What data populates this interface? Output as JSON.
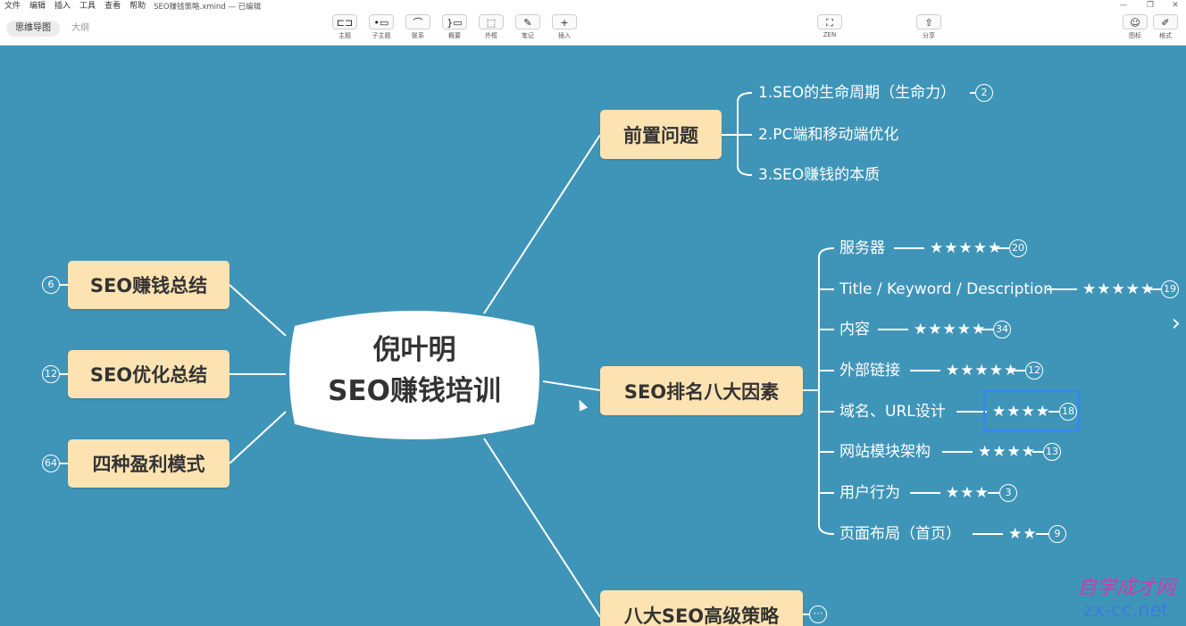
{
  "menubar": {
    "items": [
      "文件",
      "编辑",
      "插入",
      "工具",
      "查看",
      "帮助"
    ],
    "file_title": "SEO赚钱策略.xmind — 已编辑",
    "controls": [
      "—",
      "❐",
      "✕"
    ]
  },
  "toolbar": {
    "view_tabs": [
      "思维导图",
      "大纲"
    ],
    "tools": [
      {
        "icon": "⊏⊐",
        "label": "主题"
      },
      {
        "icon": "•▭",
        "label": "子主题"
      },
      {
        "icon": "⌒",
        "label": "联系"
      },
      {
        "icon": "}▭",
        "label": "概要"
      },
      {
        "icon": "⬚",
        "label": "外框"
      },
      {
        "icon": "✎",
        "label": "笔记"
      },
      {
        "icon": "+",
        "label": "插入"
      }
    ],
    "zen": {
      "icon": "⛶",
      "label": "ZEN"
    },
    "share": {
      "icon": "⇧",
      "label": "分享"
    },
    "right_tools": [
      {
        "icon": "☺",
        "label": "图标"
      },
      {
        "icon": "✐",
        "label": "格式"
      }
    ]
  },
  "mindmap": {
    "central": {
      "line1": "倪叶明",
      "line2": "SEO赚钱培训"
    },
    "left": [
      {
        "label": "SEO赚钱总结",
        "count": "6"
      },
      {
        "label": "SEO优化总结",
        "count": "12"
      },
      {
        "label": "四种盈利模式",
        "count": "64"
      }
    ],
    "right": [
      {
        "label": "前置问题",
        "children": [
          {
            "label": "1.SEO的生命周期（生命力）",
            "stars": "",
            "count": "2"
          },
          {
            "label": "2.PC端和移动端优化",
            "stars": "",
            "count": ""
          },
          {
            "label": "3.SEO赚钱的本质",
            "stars": "",
            "count": ""
          }
        ]
      },
      {
        "label": "SEO排名八大因素",
        "children": [
          {
            "label": "服务器",
            "stars": "★★★★★",
            "count": "20"
          },
          {
            "label": "Title / Keyword / Description",
            "stars": "★★★★★",
            "count": "19"
          },
          {
            "label": "内容",
            "stars": "★★★★★",
            "count": "34"
          },
          {
            "label": "外部链接",
            "stars": "★★★★★",
            "count": "12"
          },
          {
            "label": "域名、URL设计",
            "stars": "★★★★",
            "count": "18"
          },
          {
            "label": "网站模块架构",
            "stars": "★★★★",
            "count": "13"
          },
          {
            "label": "用户行为",
            "stars": "★★★",
            "count": "3"
          },
          {
            "label": "页面布局（首页）",
            "stars": "★★",
            "count": "9"
          }
        ]
      },
      {
        "label": "八大SEO高级策略",
        "collapsed": "⋯"
      }
    ]
  },
  "watermark": {
    "line1": "自学成才网",
    "line2": "zx-cc.net"
  },
  "side_arrow": "›",
  "colors": {
    "canvas": "#3f95b8",
    "topic": "#fde3b2",
    "line": "#ffffff",
    "selection": "#2f86ff"
  }
}
